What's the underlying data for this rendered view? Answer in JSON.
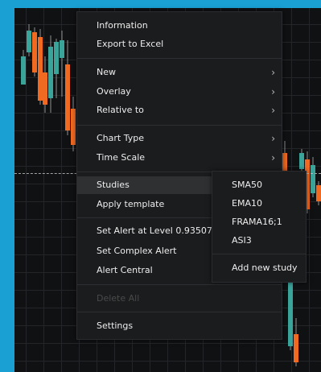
{
  "colors": {
    "background": "#101113",
    "bull": "#3aa39a",
    "bear": "#f06a22",
    "frame": "#1aa0d2",
    "menu_bg": "#1b1c1e"
  },
  "context_menu": {
    "items": [
      {
        "label": "Information"
      },
      {
        "label": "Export to Excel"
      },
      {
        "label": "New",
        "submenu": true
      },
      {
        "label": "Overlay",
        "submenu": true
      },
      {
        "label": "Relative to",
        "submenu": true
      },
      {
        "label": "Chart Type",
        "submenu": true
      },
      {
        "label": "Time Scale",
        "submenu": true
      },
      {
        "label": "Studies",
        "submenu": true,
        "highlighted": true
      },
      {
        "label": "Apply template"
      },
      {
        "label": "Set Alert at Level 0.93507"
      },
      {
        "label": "Set Complex Alert"
      },
      {
        "label": "Alert Central"
      },
      {
        "label": "Delete All",
        "disabled": true
      },
      {
        "label": "Settings"
      }
    ],
    "chevron": "›"
  },
  "studies_submenu": {
    "items": [
      {
        "label": "SMA50"
      },
      {
        "label": "EMA10"
      },
      {
        "label": "FRAMA16;1"
      },
      {
        "label": "ASI3"
      },
      {
        "label": "Add new study"
      }
    ]
  }
}
